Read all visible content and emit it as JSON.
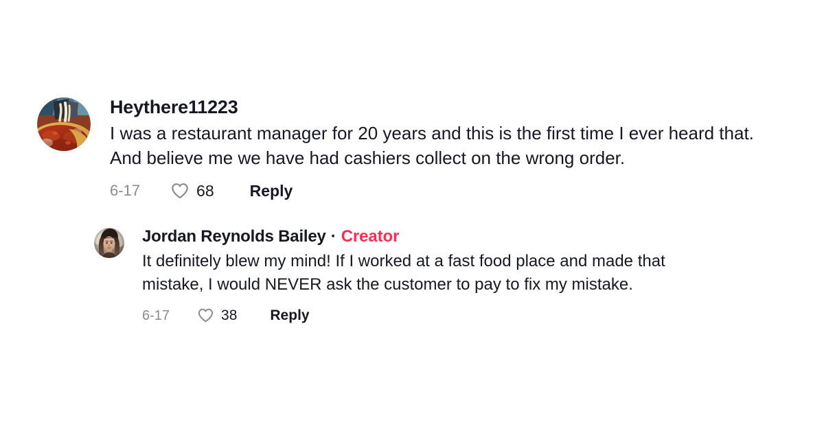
{
  "theme": {
    "background": "#ffffff",
    "text_primary": "#161823",
    "text_muted": "#8a8b91",
    "creator_accent": "#fe2c55"
  },
  "comments": [
    {
      "id": "root-comment",
      "author": "Heythere11223",
      "avatar_icon": "pizza-photo-avatar",
      "text": "I was a restaurant manager for 20 years and this is the first time I ever heard that. And believe me we have had cashiers collect on the wrong order.",
      "date": "6-17",
      "like_count": "68",
      "like_icon": "heart-icon",
      "reply_label": "Reply",
      "is_creator": false,
      "badge_label": "",
      "separator": "·"
    },
    {
      "id": "reply-comment",
      "author": "Jordan Reynolds Bailey",
      "avatar_icon": "portrait-photo-avatar",
      "text": "It definitely blew my mind! If I worked at a fast food place and made that mistake, I would NEVER ask the customer to pay to fix my mistake.",
      "date": "6-17",
      "like_count": "38",
      "like_icon": "heart-icon",
      "reply_label": "Reply",
      "is_creator": true,
      "badge_label": "Creator",
      "separator": "·"
    }
  ]
}
